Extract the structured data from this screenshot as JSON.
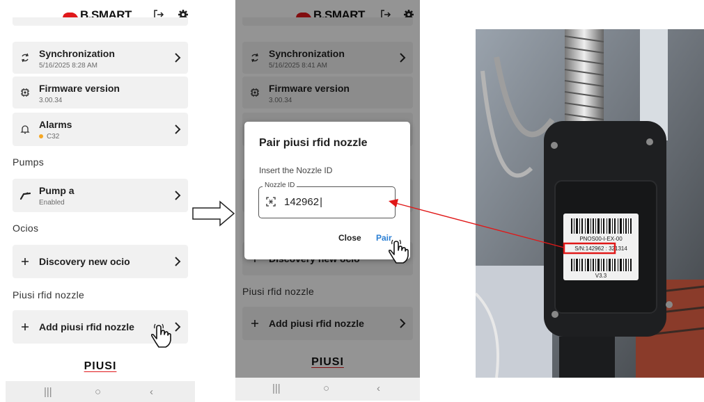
{
  "brand": {
    "name": "B.SMART",
    "logo_color": "#e0181b",
    "footer": "PIUSI"
  },
  "topbar": {
    "logout_icon": "logout-icon",
    "settings_icon": "gear-icon"
  },
  "screen1": {
    "sync": {
      "title": "Synchronization",
      "sub": "5/16/2025 8:28 AM"
    },
    "firmware": {
      "title": "Firmware version",
      "sub": "3.00.34"
    },
    "alarms": {
      "title": "Alarms",
      "sub": "C32",
      "dot_color": "#f5a623"
    },
    "pumps_header": "Pumps",
    "pump": {
      "title": "Pump a",
      "sub": "Enabled"
    },
    "ocios_header": "Ocios",
    "discovery": {
      "label": "Discovery new ocio"
    },
    "piusi_header": "Piusi rfid nozzle",
    "add_nozzle": {
      "label": "Add piusi rfid nozzle"
    }
  },
  "screen2": {
    "sync": {
      "title": "Synchronization",
      "sub": "5/16/2025 8:41 AM"
    },
    "firmware": {
      "title": "Firmware version",
      "sub": "3.00.34"
    },
    "discovery": {
      "label": "Discovery new ocio"
    },
    "piusi_header": "Piusi rfid nozzle",
    "add_nozzle": {
      "label": "Add piusi rfid nozzle"
    }
  },
  "dialog": {
    "title": "Pair piusi rfid nozzle",
    "prompt": "Insert the Nozzle ID",
    "field_label": "Nozzle ID",
    "field_value": "142962",
    "close_label": "Close",
    "pair_label": "Pair",
    "pair_color": "#2a7fd4"
  },
  "photo": {
    "label_line1": "PNOS00-I-EX-00",
    "label_sn": "S/N:142962 : 321314",
    "label_version": "V3.3",
    "highlight_color": "#e01818"
  },
  "navbar": {
    "recent": "|||",
    "home": "○",
    "back": "‹"
  }
}
